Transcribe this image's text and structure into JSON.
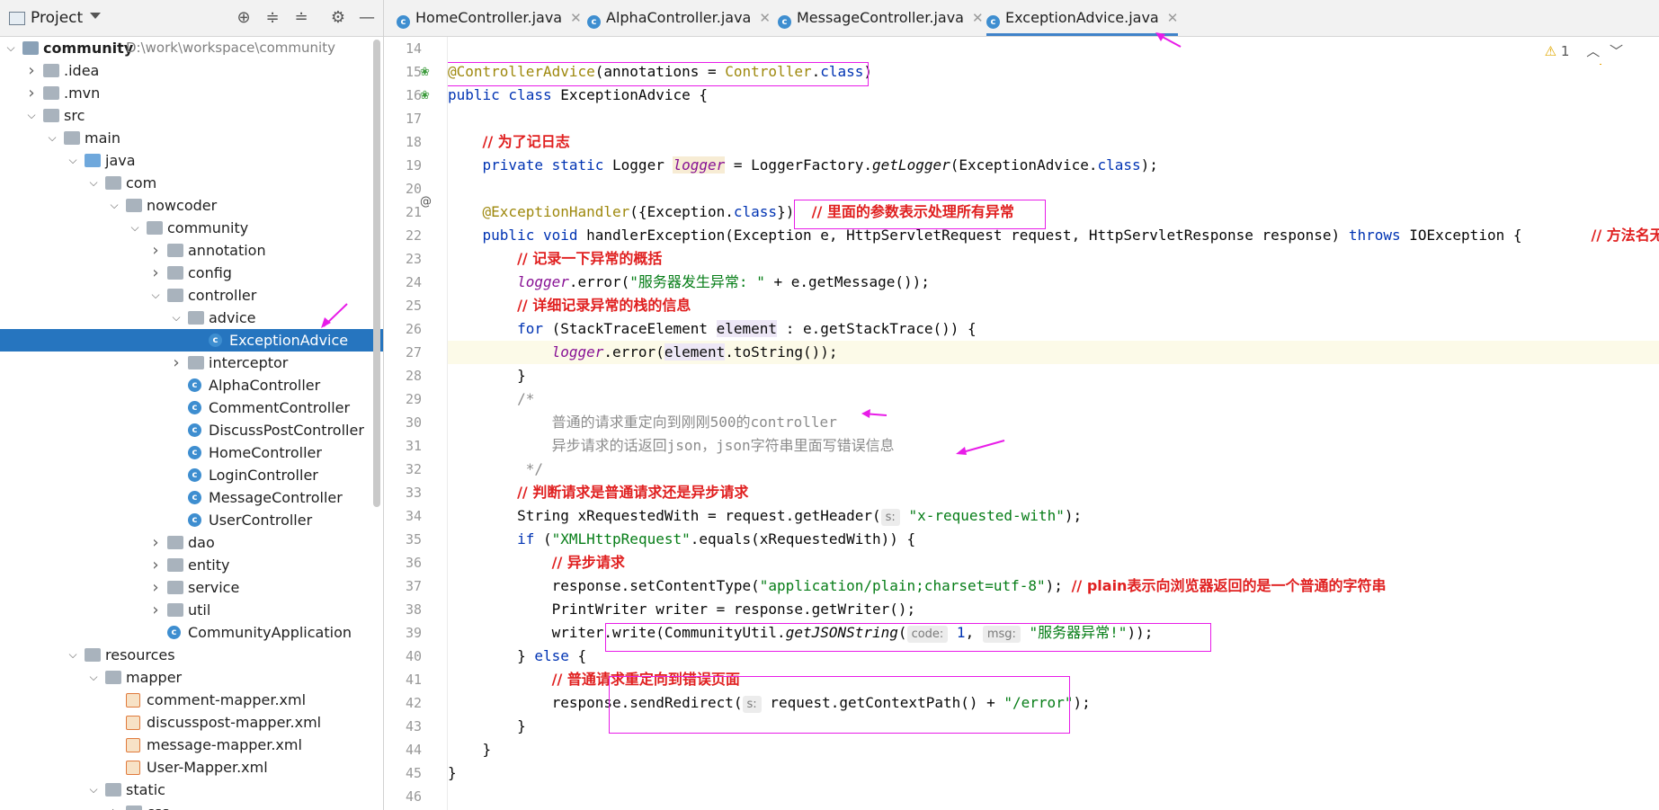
{
  "project_panel": {
    "title": "Project",
    "tree": [
      {
        "label": "community",
        "path": "D:\\work\\workspace\\community",
        "depth": 0,
        "arrow": "down",
        "icon": "folder-src",
        "bold": true
      },
      {
        "label": ".idea",
        "depth": 1,
        "arrow": "right",
        "icon": "folder"
      },
      {
        "label": ".mvn",
        "depth": 1,
        "arrow": "right",
        "icon": "folder"
      },
      {
        "label": "src",
        "depth": 1,
        "arrow": "down",
        "icon": "folder"
      },
      {
        "label": "main",
        "depth": 2,
        "arrow": "down",
        "icon": "folder"
      },
      {
        "label": "java",
        "depth": 3,
        "arrow": "down",
        "icon": "folder-blue"
      },
      {
        "label": "com",
        "depth": 4,
        "arrow": "down",
        "icon": "folder"
      },
      {
        "label": "nowcoder",
        "depth": 5,
        "arrow": "down",
        "icon": "folder"
      },
      {
        "label": "community",
        "depth": 6,
        "arrow": "down",
        "icon": "folder"
      },
      {
        "label": "annotation",
        "depth": 7,
        "arrow": "right",
        "icon": "folder"
      },
      {
        "label": "config",
        "depth": 7,
        "arrow": "right",
        "icon": "folder"
      },
      {
        "label": "controller",
        "depth": 7,
        "arrow": "down",
        "icon": "folder"
      },
      {
        "label": "advice",
        "depth": 8,
        "arrow": "down",
        "icon": "folder"
      },
      {
        "label": "ExceptionAdvice",
        "depth": 9,
        "arrow": "",
        "icon": "class",
        "selected": true
      },
      {
        "label": "interceptor",
        "depth": 8,
        "arrow": "right",
        "icon": "folder"
      },
      {
        "label": "AlphaController",
        "depth": 8,
        "arrow": "",
        "icon": "class"
      },
      {
        "label": "CommentController",
        "depth": 8,
        "arrow": "",
        "icon": "class"
      },
      {
        "label": "DiscussPostController",
        "depth": 8,
        "arrow": "",
        "icon": "class"
      },
      {
        "label": "HomeController",
        "depth": 8,
        "arrow": "",
        "icon": "class"
      },
      {
        "label": "LoginController",
        "depth": 8,
        "arrow": "",
        "icon": "class"
      },
      {
        "label": "MessageController",
        "depth": 8,
        "arrow": "",
        "icon": "class"
      },
      {
        "label": "UserController",
        "depth": 8,
        "arrow": "",
        "icon": "class"
      },
      {
        "label": "dao",
        "depth": 7,
        "arrow": "right",
        "icon": "folder"
      },
      {
        "label": "entity",
        "depth": 7,
        "arrow": "right",
        "icon": "folder"
      },
      {
        "label": "service",
        "depth": 7,
        "arrow": "right",
        "icon": "folder"
      },
      {
        "label": "util",
        "depth": 7,
        "arrow": "right",
        "icon": "folder"
      },
      {
        "label": "CommunityApplication",
        "depth": 7,
        "arrow": "",
        "icon": "class-app"
      },
      {
        "label": "resources",
        "depth": 3,
        "arrow": "down",
        "icon": "folder"
      },
      {
        "label": "mapper",
        "depth": 4,
        "arrow": "down",
        "icon": "folder"
      },
      {
        "label": "comment-mapper.xml",
        "depth": 5,
        "arrow": "",
        "icon": "xml"
      },
      {
        "label": "discusspost-mapper.xml",
        "depth": 5,
        "arrow": "",
        "icon": "xml"
      },
      {
        "label": "message-mapper.xml",
        "depth": 5,
        "arrow": "",
        "icon": "xml"
      },
      {
        "label": "User-Mapper.xml",
        "depth": 5,
        "arrow": "",
        "icon": "xml"
      },
      {
        "label": "static",
        "depth": 4,
        "arrow": "down",
        "icon": "folder"
      },
      {
        "label": "css",
        "depth": 5,
        "arrow": "right",
        "icon": "folder"
      }
    ]
  },
  "tabs": [
    {
      "label": "HomeController.java",
      "active": false
    },
    {
      "label": "AlphaController.java",
      "active": false
    },
    {
      "label": "MessageController.java",
      "active": false
    },
    {
      "label": "ExceptionAdvice.java",
      "active": true
    }
  ],
  "warning_count": "1",
  "line_numbers": [
    "14",
    "15",
    "16",
    "17",
    "18",
    "19",
    "20",
    "21",
    "22",
    "23",
    "24",
    "25",
    "26",
    "27",
    "28",
    "29",
    "30",
    "31",
    "32",
    "33",
    "34",
    "35",
    "36",
    "37",
    "38",
    "39",
    "40",
    "41",
    "42",
    "43",
    "44",
    "45",
    "46"
  ],
  "code": {
    "l15_ann": "@ControllerAdvice",
    "l15_rest": "(annotations = ",
    "l15_cls": "Controller",
    "l15_dot": ".",
    "l15_kw": "class",
    "l15_end": ")",
    "l16_kw": "public class ",
    "l16_rest": "ExceptionAdvice {",
    "l18_cm": "// 为了记日志",
    "l19_kw": "private static ",
    "l19_type": "Logger ",
    "l19_fld": "logger",
    "l19_rest": " = LoggerFactory.",
    "l19_it": "getLogger",
    "l19_rest2": "(ExceptionAdvice.",
    "l19_kw2": "class",
    "l19_end": ");",
    "l21_ann": "@ExceptionHandler",
    "l21_rest": "({Exception.",
    "l21_kw": "class",
    "l21_end": "})",
    "l21_note": "// 里面的参数表示处理所有异常",
    "l22_kw": "public void ",
    "l22_rest": "handlerException(Exception e, HttpServletRequest request, HttpServletResponse response) ",
    "l22_kw2": "throws ",
    "l22_rest2": "IOException {",
    "l22_note": "// 方法名无所谓",
    "l23_cm": "// 记录一下异常的概括",
    "l24_fld": "logger",
    "l24_rest": ".error(",
    "l24_str": "\"服务器发生异常: \"",
    "l24_rest2": " + e.getMessage());",
    "l25_cm": "// 详细记录异常的栈的信息",
    "l26_kw": "for ",
    "l26_rest": "(StackTraceElement ",
    "l26_var": "element",
    "l26_rest2": " : e.getStackTrace()) {",
    "l27_fld": "logger",
    "l27_rest": ".error(",
    "l27_var": "element",
    "l27_rest2": ".toString());",
    "l28": "}",
    "l29": "/*",
    "l30": "普通的请求重定向到刚刚500的controller",
    "l31": "异步请求的话返回json，json字符串里面写错误信息",
    "l32": " */",
    "l33_cm": "// 判断请求是普通请求还是异步请求",
    "l34_rest": "String xRequestedWith = request.getHeader(",
    "l34_hint": "s:",
    "l34_str": "\"x-requested-with\"",
    "l34_end": ");",
    "l35_kw": "if ",
    "l35_rest": "(",
    "l35_str": "\"XMLHttpRequest\"",
    "l35_rest2": ".equals(xRequestedWith)) {",
    "l36_cm": "// 异步请求",
    "l37_rest": "response.setContentType(",
    "l37_str": "\"application/plain;charset=utf-8\"",
    "l37_end": "); ",
    "l37_cm": "// plain表示向浏览器返回的是一个普通的字符串",
    "l38_rest": "PrintWriter writer = response.getWriter();",
    "l39_rest": "writer.write(CommunityUtil.",
    "l39_it": "getJSONString",
    "l39_p": "(",
    "l39_hint1": "code:",
    "l39_num": " 1",
    "l39_comma": ", ",
    "l39_hint2": "msg:",
    "l39_str": " \"服务器异常!\"",
    "l39_end": "));",
    "l40_rest": "} ",
    "l40_kw": "else",
    "l40_end": " {",
    "l41_cm": "// 普通请求重定向到错误页面",
    "l42_rest": "response.sendRedirect(",
    "l42_hint": "s:",
    "l42_rest2": " request.getContextPath() + ",
    "l42_str": "\"/error\"",
    "l42_end": ");",
    "l43": "}",
    "l44": "}",
    "l45": "}"
  },
  "colors": {
    "annotation_box": "#e81ce8",
    "selection": "#2675bf",
    "comment_red": "#e02020",
    "keyword": "#0033b3",
    "string": "#067d17"
  }
}
